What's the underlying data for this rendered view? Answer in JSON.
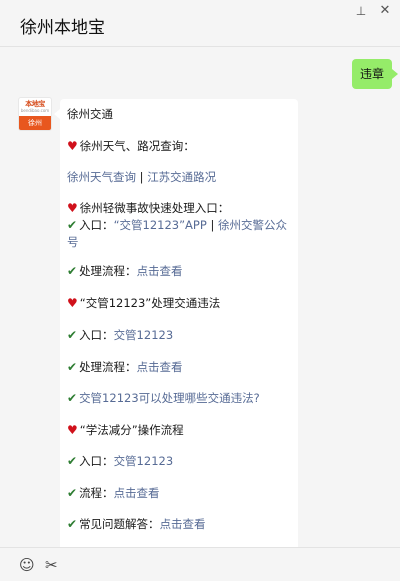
{
  "window": {
    "title": "徐州本地宝",
    "pin_icon": "⊥",
    "close_icon": "✕"
  },
  "outgoing": {
    "text": "违章"
  },
  "avatar": {
    "logo": "本地宝",
    "sub": "bendibao.com",
    "city": "徐州"
  },
  "article": {
    "header": "徐州交通",
    "sections": {
      "weather_title": "徐州天气、路况查询：",
      "weather_link1": "徐州天气查询",
      "sep1": " | ",
      "weather_link2": "江苏交通路况",
      "accident_title": "徐州轻微事故快速处理入口：",
      "accident_entry_label": "入口：",
      "accident_entry_link1": "“交管12123”APP",
      "sep2": " | ",
      "accident_entry_link2": "徐州交警公众号",
      "process_label": "处理流程：",
      "process_link": "点击查看",
      "violation_title": "“交管12123”处理交通违法",
      "v_entry_label": "入口：",
      "v_entry_link": "交管12123",
      "v_process_label": "处理流程：",
      "v_process_link": "点击查看",
      "v_which_link": "交管12123可以处理哪些交通违法?",
      "study_title": "“学法减分”操作流程",
      "s_entry_label": "入口：",
      "s_entry_link": "交管12123",
      "s_flow_label": "流程：",
      "s_flow_link": "点击查看",
      "s_faq_label": "常见问题解答：",
      "s_faq_link": "点击查看"
    }
  },
  "toolbar": {
    "emoji_icon": "☺",
    "scissors_icon": "✂"
  },
  "colors": {
    "background": "#f5f5f5",
    "outgoing_bubble": "#95ec69",
    "link": "#576b95",
    "heart": "#d0111b",
    "check": "#2e7d32",
    "avatar_accent": "#e8571e"
  }
}
